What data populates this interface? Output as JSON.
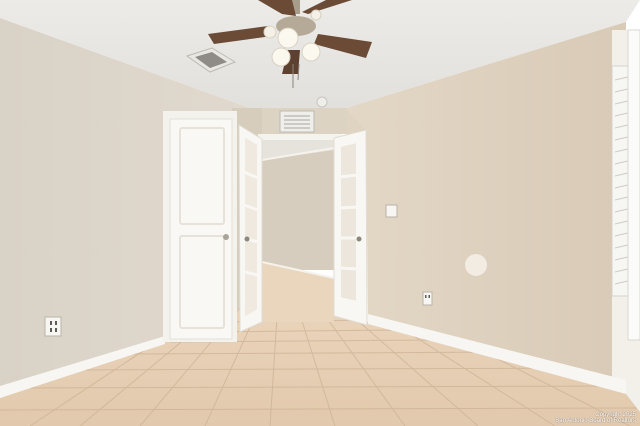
{
  "photo_credit": {
    "line1": "Copyright 2025",
    "line2": "San Antonio Board of Realtors"
  }
}
